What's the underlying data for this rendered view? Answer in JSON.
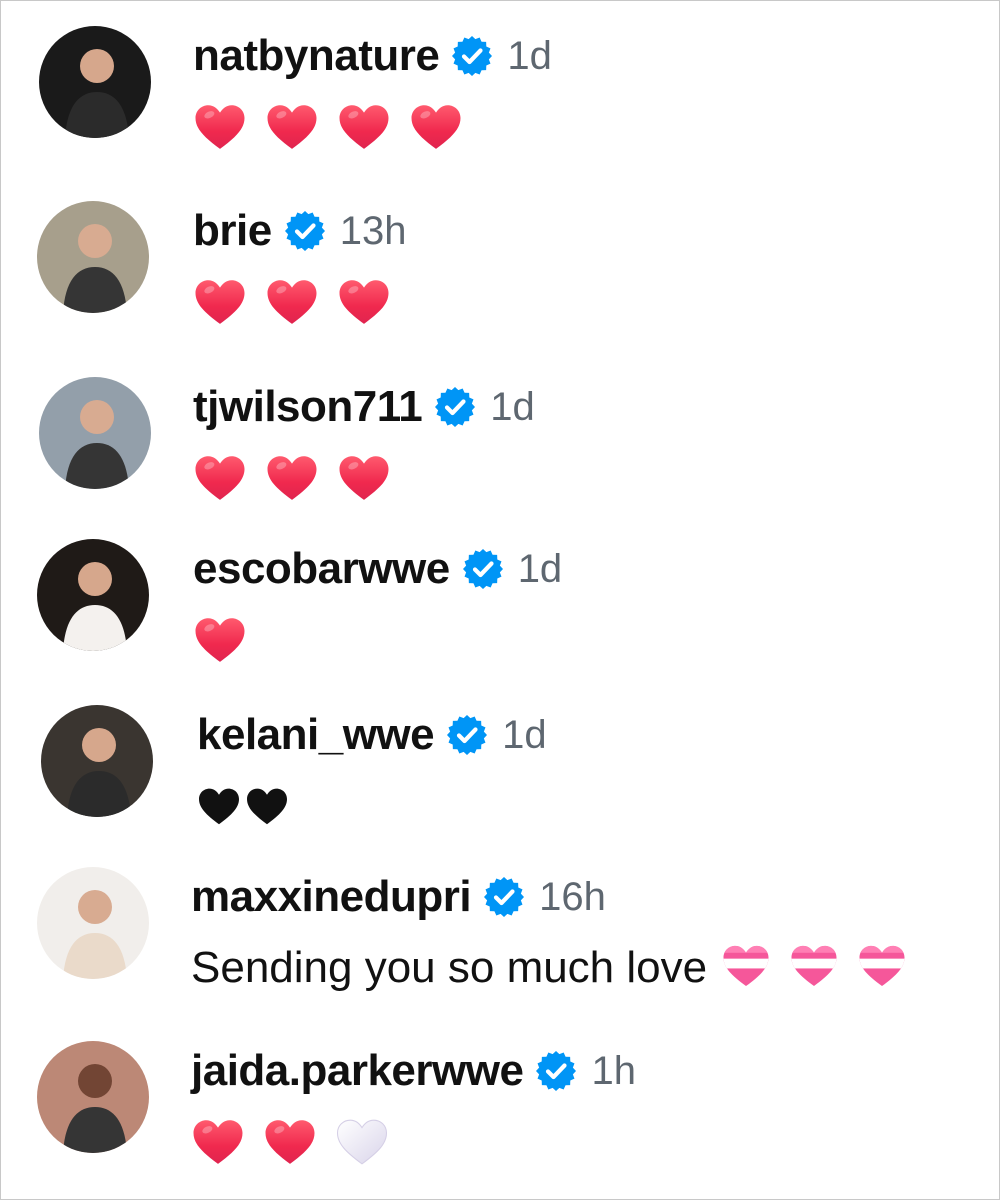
{
  "comments": [
    {
      "username": "natbynature",
      "time": "1d",
      "text": "",
      "hearts": [
        "red-heart-icon",
        "red-heart-icon",
        "red-heart-icon",
        "red-heart-icon"
      ],
      "avatar_bg": "#1a1a1a"
    },
    {
      "username": "brie",
      "time": "13h",
      "text": "",
      "hearts": [
        "red-heart-icon",
        "red-heart-icon",
        "red-heart-icon"
      ],
      "avatar_bg": "#a39a86"
    },
    {
      "username": "tjwilson711",
      "time": "1d",
      "text": "",
      "hearts": [
        "red-heart-icon",
        "red-heart-icon",
        "red-heart-icon"
      ],
      "avatar_bg": "#8e9aa6"
    },
    {
      "username": "escobarwwe",
      "time": "1d",
      "text": "",
      "hearts": [
        "red-heart-icon"
      ],
      "avatar_bg": "#1f1a17"
    },
    {
      "username": "kelani_wwe",
      "time": "1d",
      "text": "",
      "hearts": [
        "black-heart-icon",
        "black-heart-icon"
      ],
      "avatar_bg": "#3a3530"
    },
    {
      "username": "maxxinedupri",
      "time": "16h",
      "text": "Sending you so much love",
      "hearts": [
        "pink-white-heart-icon",
        "pink-white-heart-icon",
        "pink-white-heart-icon"
      ],
      "avatar_bg": "#f1eeea"
    },
    {
      "username": "jaida.parkerwwe",
      "time": "1h",
      "text": "",
      "hearts": [
        "red-heart-icon",
        "red-heart-icon",
        "white-heart-icon"
      ],
      "avatar_bg": "#b9826f"
    }
  ],
  "colors": {
    "verified": "#0095f6",
    "timestamp": "#5e6770",
    "heart_red": "#f0294e"
  }
}
